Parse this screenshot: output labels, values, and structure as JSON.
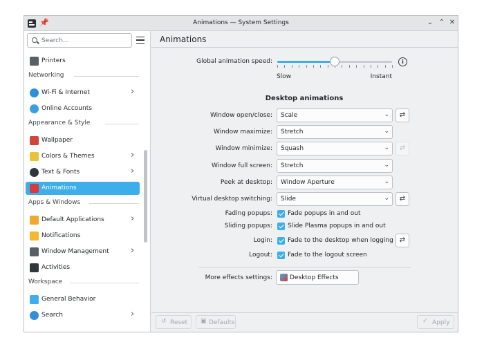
{
  "window": {
    "title": "Animations — System Settings",
    "buttons": {
      "minimize": "⌄",
      "maximize": "⌃",
      "close": "✕"
    }
  },
  "sidebar": {
    "search_placeholder": "Search...",
    "items": [
      {
        "type": "item",
        "label": "Printers",
        "icon": "printer-icon",
        "color": "#5a5f64",
        "chevron": false
      },
      {
        "type": "section",
        "label": "Networking"
      },
      {
        "type": "item",
        "label": "Wi-Fi & Internet",
        "icon": "globe-icon",
        "color": "#2f8fd8",
        "chevron": true
      },
      {
        "type": "item",
        "label": "Online Accounts",
        "icon": "online-accounts-icon",
        "color": "#3c9ee0",
        "chevron": false
      },
      {
        "type": "section",
        "label": "Appearance & Style"
      },
      {
        "type": "item",
        "label": "Wallpaper",
        "icon": "wallpaper-icon",
        "color": "#d0463a",
        "chevron": false
      },
      {
        "type": "item",
        "label": "Colors & Themes",
        "icon": "palette-icon",
        "color": "#e8c33a",
        "chevron": true
      },
      {
        "type": "item",
        "label": "Text & Fonts",
        "icon": "font-icon",
        "color": "#31363b",
        "chevron": true
      },
      {
        "type": "item",
        "label": "Animations",
        "icon": "animation-icon",
        "color": "#d63a3a",
        "chevron": false,
        "active": true
      },
      {
        "type": "section",
        "label": "Apps & Windows"
      },
      {
        "type": "item",
        "label": "Default Applications",
        "icon": "star-icon",
        "color": "#f0a830",
        "chevron": true
      },
      {
        "type": "item",
        "label": "Notifications",
        "icon": "bell-icon",
        "color": "#f5b82e",
        "chevron": false
      },
      {
        "type": "item",
        "label": "Window Management",
        "icon": "window-icon",
        "color": "#5a5f64",
        "chevron": true
      },
      {
        "type": "item",
        "label": "Activities",
        "icon": "activities-icon",
        "color": "#31363b",
        "chevron": false
      },
      {
        "type": "section",
        "label": "Workspace"
      },
      {
        "type": "item",
        "label": "General Behavior",
        "icon": "general-behavior-icon",
        "color": "#3daee9",
        "chevron": false
      },
      {
        "type": "item",
        "label": "Search",
        "icon": "search-icon",
        "color": "#2f8fd8",
        "chevron": true
      }
    ]
  },
  "main": {
    "title": "Animations",
    "speed": {
      "label": "Global animation speed:",
      "min_label": "Slow",
      "max_label": "Instant",
      "value": 0.5
    },
    "section_title": "Desktop animations",
    "combos": [
      {
        "label": "Window open/close:",
        "value": "Scale",
        "config": "enabled"
      },
      {
        "label": "Window maximize:",
        "value": "Stretch",
        "config": "none"
      },
      {
        "label": "Window minimize:",
        "value": "Squash",
        "config": "disabled"
      },
      {
        "label": "Window full screen:",
        "value": "Stretch",
        "config": "none"
      },
      {
        "label": "Peek at desktop:",
        "value": "Window Aperture",
        "config": "none"
      },
      {
        "label": "Virtual desktop switching:",
        "value": "Slide",
        "config": "enabled"
      }
    ],
    "checks": [
      {
        "label": "Fading popups:",
        "text": "Fade popups in and out",
        "checked": true,
        "config": "none"
      },
      {
        "label": "Sliding popups:",
        "text": "Slide Plasma popups in and out",
        "checked": true,
        "config": "none"
      },
      {
        "label": "Login:",
        "text": "Fade to the desktop when logging in",
        "checked": true,
        "config": "enabled"
      },
      {
        "label": "Logout:",
        "text": "Fade to the logout screen",
        "checked": true,
        "config": "none"
      }
    ],
    "more_effects": {
      "label": "More effects settings:",
      "button": "Desktop Effects"
    }
  },
  "footer": {
    "reset": "Reset",
    "defaults": "Defaults",
    "apply": "Apply"
  },
  "colors": {
    "accent": "#3daee9",
    "window_bg": "#eff0f1"
  }
}
